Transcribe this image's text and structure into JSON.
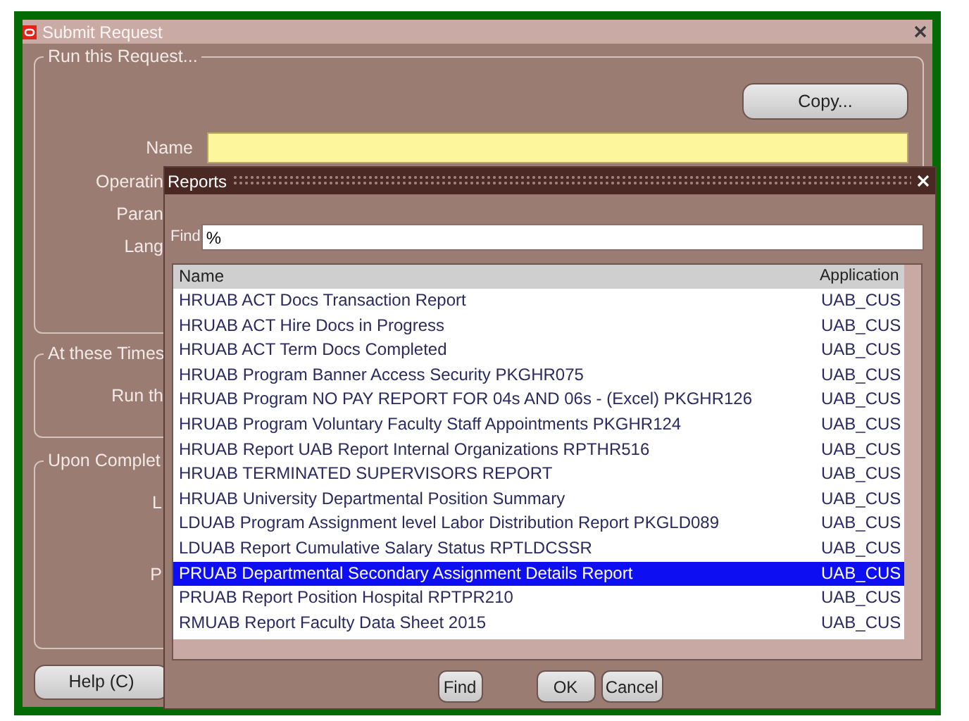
{
  "window": {
    "title": "Submit Request"
  },
  "run_group": {
    "title": "Run this Request...",
    "copy_button": "Copy...",
    "name_label": "Name",
    "labels": [
      "Operatin",
      "Paran",
      "Lang"
    ]
  },
  "times_group": {
    "title": "At these Times",
    "labels": [
      "Run th"
    ]
  },
  "completion_group": {
    "title": "Upon Complet",
    "labels": [
      "L",
      "P"
    ]
  },
  "help_button": "Help (C)",
  "reports_dialog": {
    "title": "Reports",
    "find_label": "Find",
    "find_value": "%",
    "columns": [
      "Name",
      "Application"
    ],
    "rows": [
      {
        "name": "HRUAB ACT Docs Transaction Report",
        "application": "UAB_CUS",
        "selected": false
      },
      {
        "name": "HRUAB ACT Hire Docs in Progress",
        "application": "UAB_CUS",
        "selected": false
      },
      {
        "name": "HRUAB ACT Term Docs Completed",
        "application": "UAB_CUS",
        "selected": false
      },
      {
        "name": "HRUAB Program Banner Access Security PKGHR075",
        "application": "UAB_CUS",
        "selected": false
      },
      {
        "name": "HRUAB Program NO PAY REPORT FOR 04s AND 06s - (Excel) PKGHR126",
        "application": "UAB_CUS",
        "selected": false
      },
      {
        "name": "HRUAB Program Voluntary Faculty Staff Appointments PKGHR124",
        "application": "UAB_CUS",
        "selected": false
      },
      {
        "name": "HRUAB Report UAB Report Internal Organizations RPTHR516",
        "application": "UAB_CUS",
        "selected": false
      },
      {
        "name": "HRUAB TERMINATED SUPERVISORS REPORT",
        "application": "UAB_CUS",
        "selected": false
      },
      {
        "name": "HRUAB University Departmental Position Summary",
        "application": "UAB_CUS",
        "selected": false
      },
      {
        "name": "LDUAB Program Assignment level Labor Distribution Report PKGLD089",
        "application": "UAB_CUS",
        "selected": false
      },
      {
        "name": "LDUAB Report Cumulative Salary Status RPTLDCSSR",
        "application": "UAB_CUS",
        "selected": false
      },
      {
        "name": "PRUAB Departmental Secondary Assignment Details Report",
        "application": "UAB_CUS",
        "selected": true
      },
      {
        "name": "PRUAB Report Position Hospital RPTPR210",
        "application": "UAB_CUS",
        "selected": false
      },
      {
        "name": "RMUAB Report Faculty Data Sheet 2015",
        "application": "UAB_CUS",
        "selected": false
      }
    ],
    "buttons": [
      "Find",
      "OK",
      "Cancel"
    ]
  }
}
